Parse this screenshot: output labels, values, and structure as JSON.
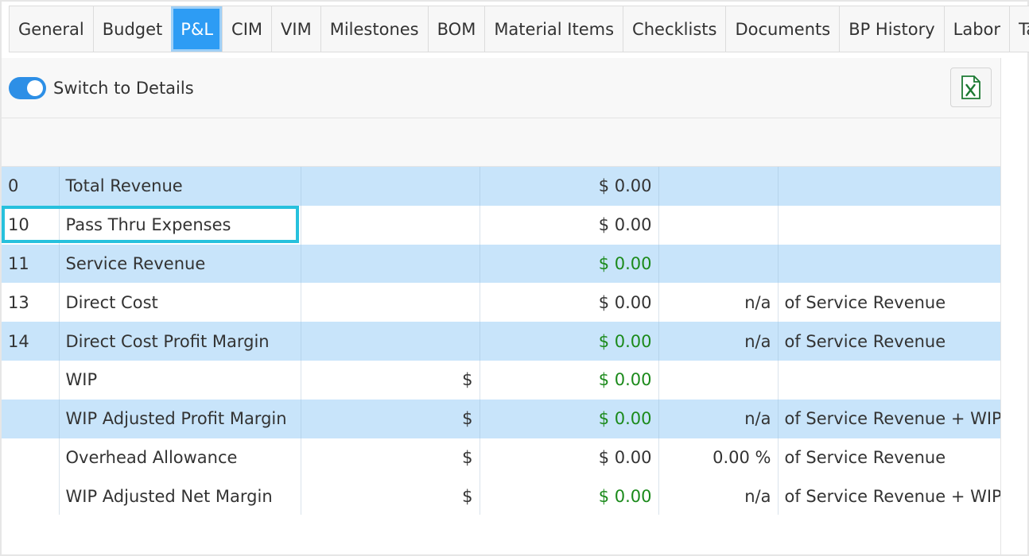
{
  "tabs": [
    {
      "label": "General"
    },
    {
      "label": "Budget"
    },
    {
      "label": "P&L",
      "active": true
    },
    {
      "label": "CIM"
    },
    {
      "label": "VIM"
    },
    {
      "label": "Milestones"
    },
    {
      "label": "BOM"
    },
    {
      "label": "Material Items"
    },
    {
      "label": "Checklists"
    },
    {
      "label": "Documents"
    },
    {
      "label": "BP History"
    },
    {
      "label": "Labor"
    },
    {
      "label": "Tasks"
    }
  ],
  "toolbar": {
    "toggle_label": "Switch to Details",
    "toggle_on": true,
    "export_icon": "excel-icon"
  },
  "rows": [
    {
      "num": "0",
      "label": "Total Revenue",
      "cur": "",
      "value": "$ 0.00",
      "value_green": false,
      "pct": "",
      "note": "",
      "highlight": true
    },
    {
      "num": "10",
      "label": "Pass Thru Expenses",
      "cur": "",
      "value": "$ 0.00",
      "value_green": false,
      "pct": "",
      "note": "",
      "highlight": false
    },
    {
      "num": "11",
      "label": "Service Revenue",
      "cur": "",
      "value": "$ 0.00",
      "value_green": true,
      "pct": "",
      "note": "",
      "highlight": true
    },
    {
      "num": "13",
      "label": "Direct Cost",
      "cur": "",
      "value": "$ 0.00",
      "value_green": false,
      "pct": "n/a",
      "note": "of Service Revenue",
      "highlight": false
    },
    {
      "num": "14",
      "label": "Direct Cost Profit Margin",
      "cur": "",
      "value": "$ 0.00",
      "value_green": true,
      "pct": "n/a",
      "note": "of Service Revenue",
      "highlight": true
    },
    {
      "num": "",
      "label": "WIP",
      "cur": "$",
      "value": "$ 0.00",
      "value_green": true,
      "pct": "",
      "note": "",
      "highlight": false
    },
    {
      "num": "",
      "label": "WIP Adjusted Profit Margin",
      "cur": "$",
      "value": "$ 0.00",
      "value_green": true,
      "pct": "n/a",
      "note": "of Service Revenue + WIP",
      "highlight": true
    },
    {
      "num": "",
      "label": "Overhead Allowance",
      "cur": "$",
      "value": "$ 0.00",
      "value_green": false,
      "pct": "0.00 %",
      "note": "of Service Revenue",
      "highlight": false
    },
    {
      "num": "",
      "label": "WIP Adjusted Net Margin",
      "cur": "$",
      "value": "$ 0.00",
      "value_green": true,
      "pct": "n/a",
      "note": "of Service Revenue + WIP",
      "highlight": false
    }
  ],
  "colors": {
    "accent": "#2d9cf4",
    "row_highlight": "#c8e4fa",
    "positive": "#1b8a1b",
    "focus_outline": "#27c1dd"
  }
}
